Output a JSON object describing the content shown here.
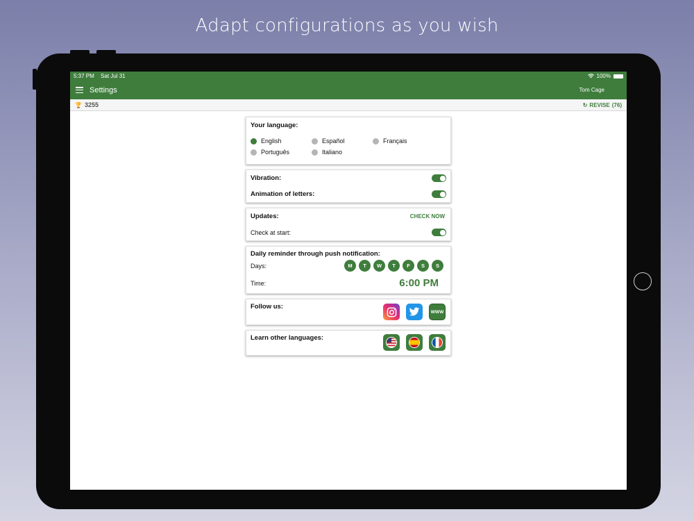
{
  "promo_title": "Adapt configurations  as you wish",
  "statusbar": {
    "time": "5:37 PM",
    "date": "Sat Jul 31",
    "battery": "100%"
  },
  "appbar": {
    "title": "Settings",
    "user": "Tom Cage"
  },
  "scorebar": {
    "score": "3255",
    "revise_label": "REVISE",
    "revise_count": "(76)"
  },
  "language_card": {
    "title": "Your language:",
    "selected": "English",
    "options": [
      "English",
      "Español",
      "Français",
      "Português",
      "Italiano"
    ]
  },
  "vibration_card": {
    "vibration_label": "Vibration:",
    "vibration_on": true,
    "animation_label": "Animation of letters:",
    "animation_on": true
  },
  "updates_card": {
    "title": "Updates:",
    "check_now_label": "CHECK NOW",
    "check_at_start_label": "Check at start:",
    "check_at_start_on": true
  },
  "reminder_card": {
    "title": "Daily reminder through push notification:",
    "days_label": "Days:",
    "days": [
      "M",
      "T",
      "W",
      "T",
      "F",
      "S",
      "S"
    ],
    "time_label": "Time:",
    "time_value": "6:00 PM"
  },
  "follow_card": {
    "title": "Follow us:",
    "icons": [
      "instagram-icon",
      "twitter-icon",
      "www-icon"
    ],
    "www_text": "WWW"
  },
  "learn_card": {
    "title": "Learn other languages:",
    "icons": [
      "us-flag-icon",
      "spain-flag-icon",
      "france-flag-icon"
    ]
  },
  "colors": {
    "primary": "#3f7d3d",
    "bg_top": "#7b7fa9",
    "bg_bottom": "#d4d5e3"
  }
}
